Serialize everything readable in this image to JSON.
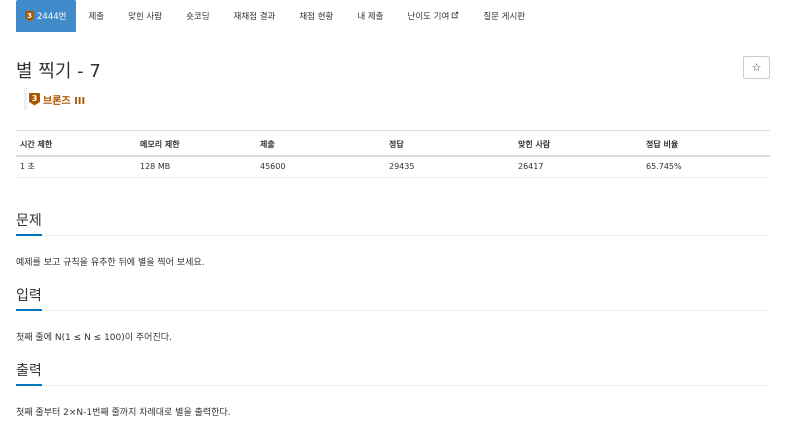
{
  "tabs": [
    {
      "label": "2444번",
      "badge": "3",
      "active": true
    },
    {
      "label": "제출"
    },
    {
      "label": "맞힌 사람"
    },
    {
      "label": "숏코딩"
    },
    {
      "label": "재채점 결과"
    },
    {
      "label": "채점 현황"
    },
    {
      "label": "내 제출"
    },
    {
      "label": "난이도 기여",
      "icon": "external-link-icon"
    },
    {
      "label": "질문 게시판"
    }
  ],
  "problem": {
    "title": "별 찍기 - 7",
    "star_button": "☆",
    "tier": {
      "badge": "3",
      "label": "브론즈 III",
      "color": "#ad5600"
    }
  },
  "info_table": {
    "headers": [
      "시간 제한",
      "메모리 제한",
      "제출",
      "정답",
      "맞힌 사람",
      "정답 비율"
    ],
    "values": [
      "1 초",
      "128 MB",
      "45600",
      "29435",
      "26417",
      "65.745%"
    ]
  },
  "sections": {
    "problem": {
      "title": "문제",
      "body": "예제를 보고 규칙을 유추한 뒤에 별을 찍어 보세요."
    },
    "input": {
      "title": "입력",
      "body": "첫째 줄에 N(1 ≤ N ≤ 100)이 주어진다."
    },
    "output": {
      "title": "출력",
      "body": "첫째 줄부터 2×N-1번째 줄까지 차례대로 별을 출력한다."
    }
  },
  "colors": {
    "accent": "#428bca",
    "bronze": "#ad5600",
    "section_underline": "#0076c0"
  }
}
